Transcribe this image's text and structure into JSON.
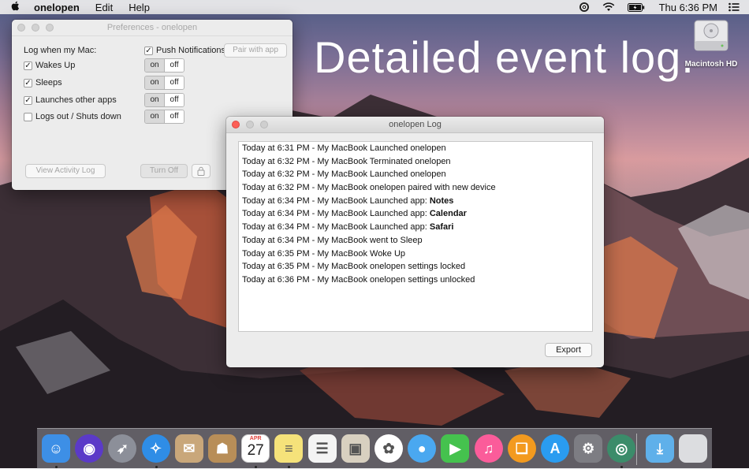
{
  "menubar": {
    "apple": "",
    "app_name": "onelopen",
    "menus": [
      "Edit",
      "Help"
    ],
    "clock": "Thu 6:36 PM"
  },
  "desktop": {
    "headline": "Detailed event log.",
    "drive_label": "Macintosh HD"
  },
  "preferences": {
    "title": "Preferences - onelopen",
    "log_when_label": "Log when my Mac:",
    "options": [
      {
        "label": "Wakes Up",
        "checked": true,
        "on": "on",
        "off": "off"
      },
      {
        "label": "Sleeps",
        "checked": true,
        "on": "on",
        "off": "off"
      },
      {
        "label": "Launches other apps",
        "checked": true,
        "on": "on",
        "off": "off"
      },
      {
        "label": "Logs out / Shuts down",
        "checked": false,
        "on": "on",
        "off": "off"
      }
    ],
    "push_label": "Push Notifications:",
    "push_checked": true,
    "pair_button": "Pair with app",
    "view_log_button": "View Activity Log",
    "turn_off_button": "Turn Off"
  },
  "log_window": {
    "title": "onelopen Log",
    "entries": [
      {
        "text": "Today at 6:31 PM - My MacBook Launched onelopen",
        "bold": ""
      },
      {
        "text": "Today at 6:32 PM - My MacBook Terminated onelopen",
        "bold": ""
      },
      {
        "text": "Today at 6:32 PM - My MacBook Launched onelopen",
        "bold": ""
      },
      {
        "text": "Today at 6:32 PM - My MacBook onelopen paired with new device",
        "bold": ""
      },
      {
        "text": "Today at 6:34 PM - My MacBook Launched app: ",
        "bold": "Notes"
      },
      {
        "text": "Today at 6:34 PM - My MacBook Launched app: ",
        "bold": "Calendar"
      },
      {
        "text": "Today at 6:34 PM - My MacBook Launched app: ",
        "bold": "Safari"
      },
      {
        "text": "Today at 6:34 PM - My MacBook went to Sleep",
        "bold": ""
      },
      {
        "text": "Today at 6:35 PM - My MacBook Woke Up",
        "bold": ""
      },
      {
        "text": "Today at 6:35 PM - My MacBook onelopen settings locked",
        "bold": ""
      },
      {
        "text": "Today at 6:36 PM - My MacBook onelopen settings unlocked",
        "bold": ""
      }
    ],
    "export_button": "Export"
  },
  "dock": {
    "calendar_month": "APR",
    "calendar_day": "27",
    "apps": [
      {
        "icon": "finder-icon",
        "color": "#3d8fe6",
        "running": true
      },
      {
        "icon": "siri-icon",
        "color": "#5b3ac8",
        "running": false
      },
      {
        "icon": "launchpad-icon",
        "color": "#8c8f99",
        "running": false
      },
      {
        "icon": "safari-icon",
        "color": "#2f8de6",
        "running": true
      },
      {
        "icon": "mail-icon",
        "color": "#c9a77a",
        "running": false
      },
      {
        "icon": "contacts-icon",
        "color": "#b88e58",
        "running": false
      },
      {
        "icon": "calendar-icon",
        "color": "#ffffff",
        "running": true
      },
      {
        "icon": "notes-icon",
        "color": "#f5e27a",
        "running": true
      },
      {
        "icon": "reminders-icon",
        "color": "#f4f4f4",
        "running": false
      },
      {
        "icon": "preview-icon",
        "color": "#d8d0c0",
        "running": false
      },
      {
        "icon": "photos-icon",
        "color": "#ffffff",
        "running": false
      },
      {
        "icon": "messages-icon",
        "color": "#4aa8f0",
        "running": false
      },
      {
        "icon": "facetime-icon",
        "color": "#45c24e",
        "running": false
      },
      {
        "icon": "itunes-icon",
        "color": "#fb5c9a",
        "running": false
      },
      {
        "icon": "ibooks-icon",
        "color": "#f39a1f",
        "running": false
      },
      {
        "icon": "app-store-icon",
        "color": "#2a9cf0",
        "running": false
      },
      {
        "icon": "system-preferences-icon",
        "color": "#7d7d83",
        "running": false
      },
      {
        "icon": "onelopen-icon",
        "color": "#3b8c6a",
        "running": true
      }
    ],
    "trailing": [
      {
        "icon": "downloads-folder-icon",
        "color": "#5fb0ea"
      },
      {
        "icon": "trash-icon",
        "color": "#dcdde0"
      }
    ]
  }
}
